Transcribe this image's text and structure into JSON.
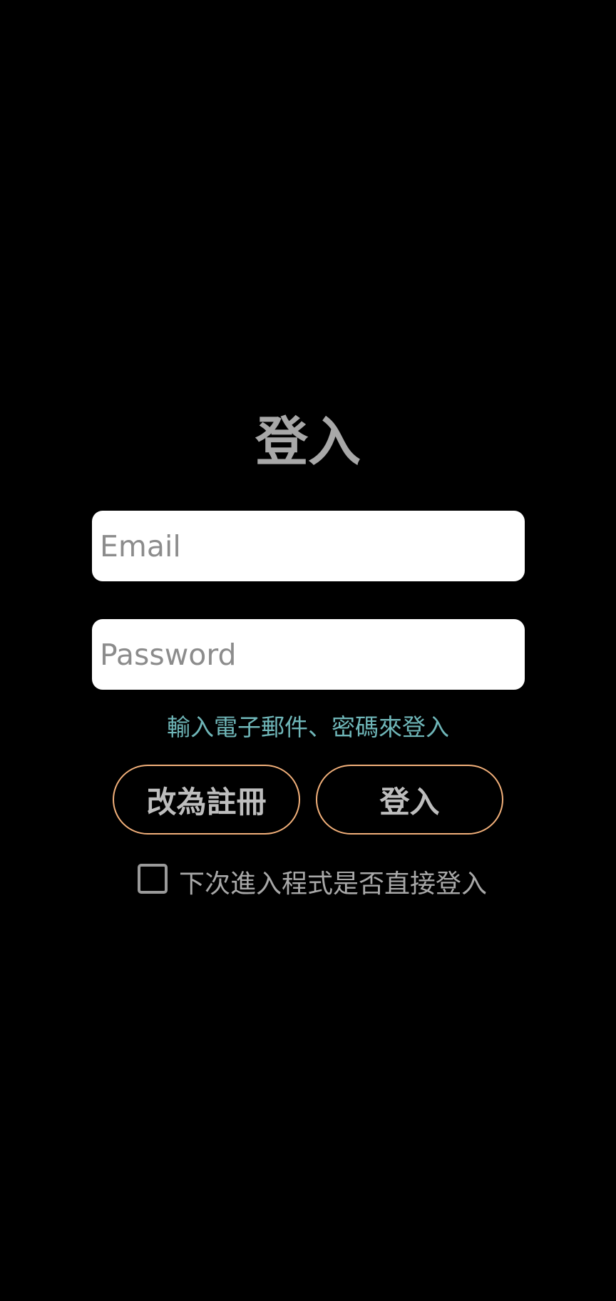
{
  "login": {
    "title": "登入",
    "email_placeholder": "Email",
    "password_placeholder": "Password",
    "hint": "輸入電子郵件、密碼來登入",
    "register_label": "改為註冊",
    "login_label": "登入",
    "remember_label": "下次進入程式是否直接登入",
    "remember_checked": false
  },
  "colors": {
    "background": "#000000",
    "title_text": "#a8a8a8",
    "hint_text": "#6fb6b8",
    "button_border": "#f2b07a",
    "button_text": "#bdbdbd"
  }
}
